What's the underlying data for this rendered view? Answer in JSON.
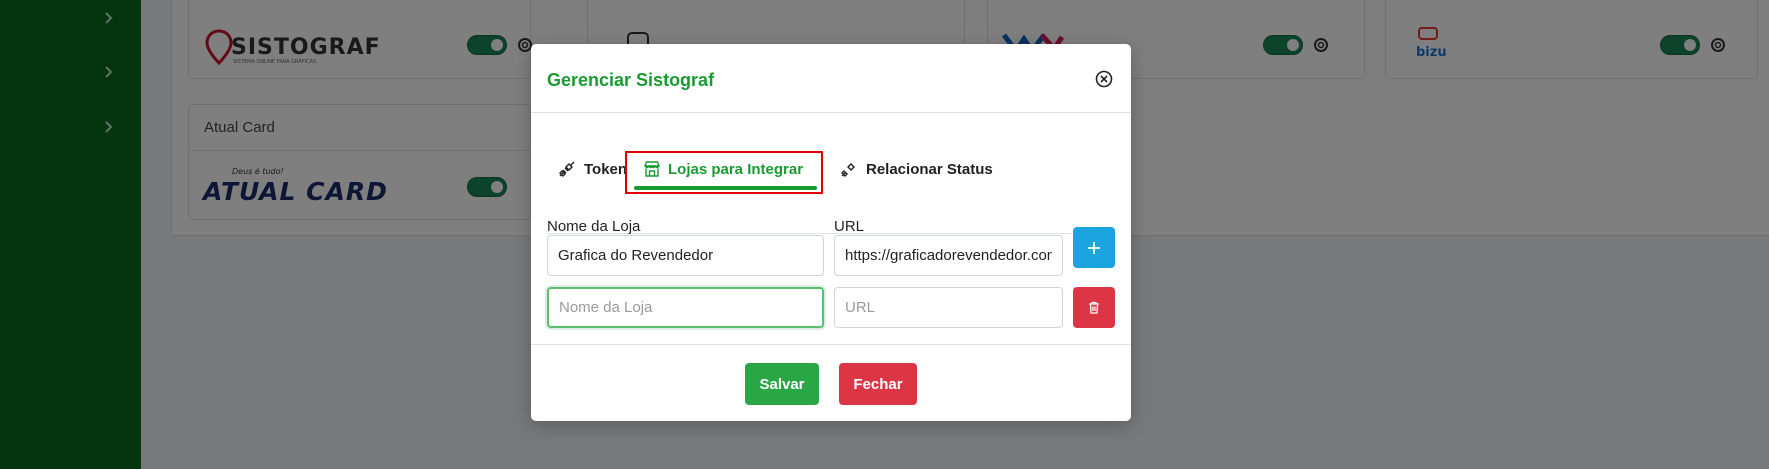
{
  "background": {
    "cards": [
      {
        "logo": "SISTOGRAF",
        "logo_tagline": "SISTEMA ONLINE PARA GRÁFICAS"
      },
      {
        "logo": ""
      },
      {
        "logo": ""
      },
      {
        "logo": "bizu"
      },
      {
        "title": "Atual Card",
        "logo": "ATUAL CARD",
        "logo_tagline": "Deus é tudo!"
      }
    ]
  },
  "modal": {
    "title": "Gerenciar Sistograf",
    "tabs": [
      {
        "label": "Token",
        "icon": "plug-icon"
      },
      {
        "label": "Lojas para Integrar",
        "icon": "store-icon",
        "active": true
      },
      {
        "label": "Relacionar Status",
        "icon": "plug-icon"
      }
    ],
    "form": {
      "name_label": "Nome da Loja",
      "url_label": "URL",
      "rows": [
        {
          "name_value": "Grafica do Revendedor",
          "url_value": "https://graficadorevendedor.com",
          "name_placeholder": "",
          "url_placeholder": ""
        },
        {
          "name_value": "",
          "url_value": "",
          "name_placeholder": "Nome da Loja",
          "url_placeholder": "URL"
        }
      ]
    },
    "buttons": {
      "save": "Salvar",
      "close": "Fechar"
    }
  },
  "colors": {
    "accent": "#1a9b32",
    "sidebar": "#0b6b1e",
    "danger": "#dc3545",
    "info": "#1aa4e0"
  }
}
